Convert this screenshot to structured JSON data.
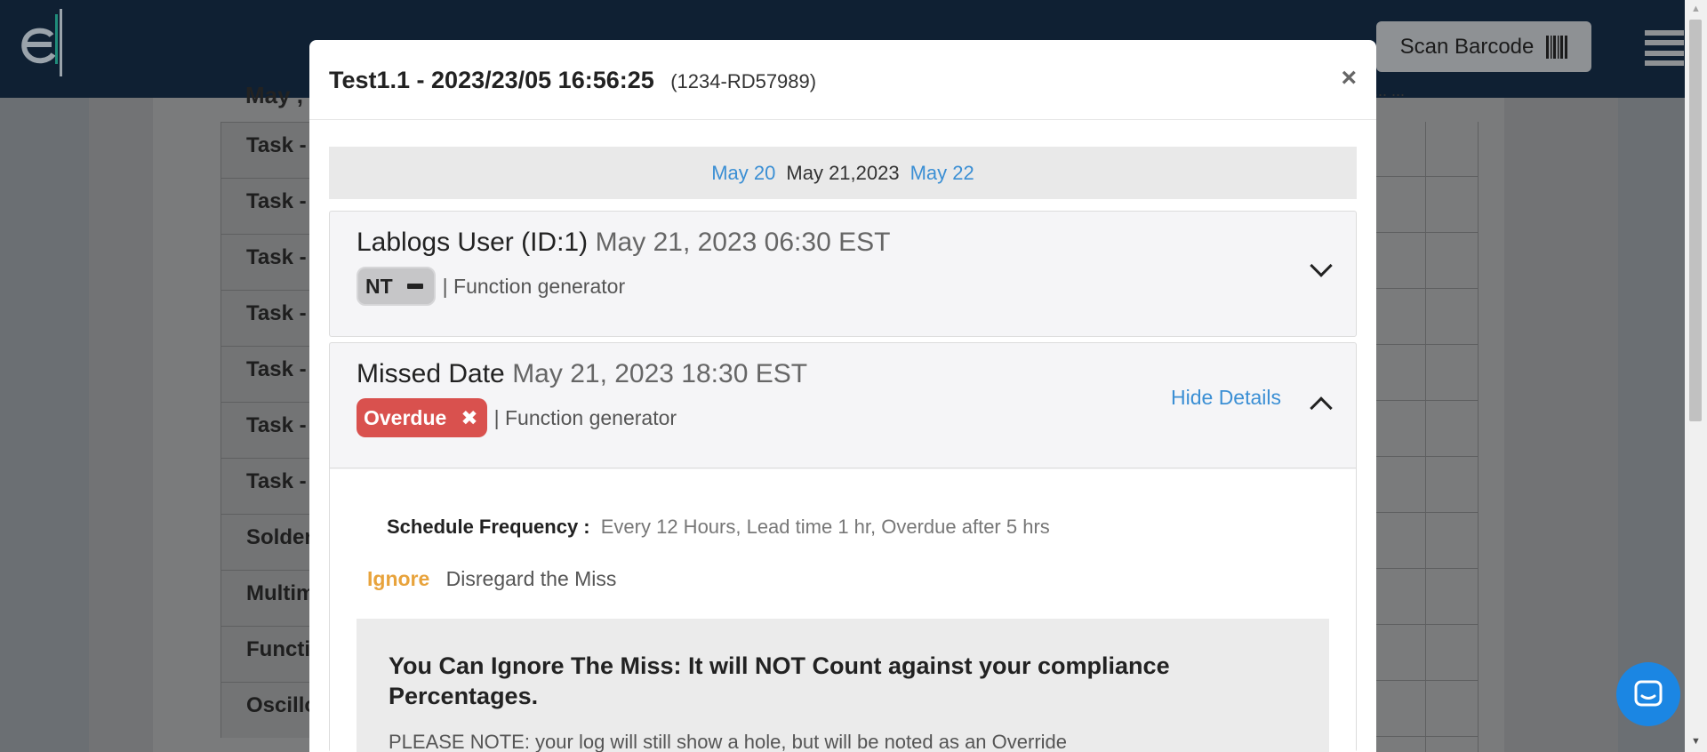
{
  "background": {
    "scan_label": "Scan Barcode",
    "month_label": "May ,",
    "month_right": "...  ...",
    "rows": [
      "Task -",
      "Task -",
      "Task -",
      "Task -",
      "Task -",
      "Task -",
      "Task -",
      "Solder",
      "Multim",
      "Functio",
      "Oscillo"
    ]
  },
  "modal": {
    "title": "Test1.1 - 2023/23/05 16:56:25",
    "subtitle": "(1234-RD57989)",
    "close": "×",
    "date_nav": {
      "prev": "May 20",
      "current": "May 21,2023",
      "next": "May 22"
    },
    "entries": [
      {
        "title": "Lablogs User (ID:1)",
        "time": "May 21, 2023 06:30 EST",
        "badge": "NT",
        "meta": "| Function generator"
      },
      {
        "title": "Missed Date",
        "time": "May 21, 2023 18:30 EST",
        "badge": "Overdue",
        "badge_icon": "✖",
        "meta": "| Function generator",
        "hide_details": "Hide Details",
        "frequency_label": "Schedule Frequency :",
        "frequency_value": "Every 12 Hours, Lead time 1 hr, Overdue after 5 hrs",
        "ignore_label": "Ignore",
        "ignore_text": "Disregard the Miss",
        "note_title": "You Can Ignore The Miss: It will NOT Count against your compliance Percentages.",
        "note_text": "PLEASE NOTE: your log will still show a hole, but will be noted as an Override"
      }
    ]
  },
  "colors": {
    "topbar": "#0f2033",
    "link": "#3b8fd4",
    "overdue": "#d9514e",
    "ignore": "#e8a33c",
    "chat": "#1b86e3"
  },
  "icons": [
    "logo-icon",
    "barcode-icon",
    "hamburger-icon",
    "chevron-down-icon",
    "chevron-up-icon",
    "close-icon",
    "chat-icon"
  ]
}
